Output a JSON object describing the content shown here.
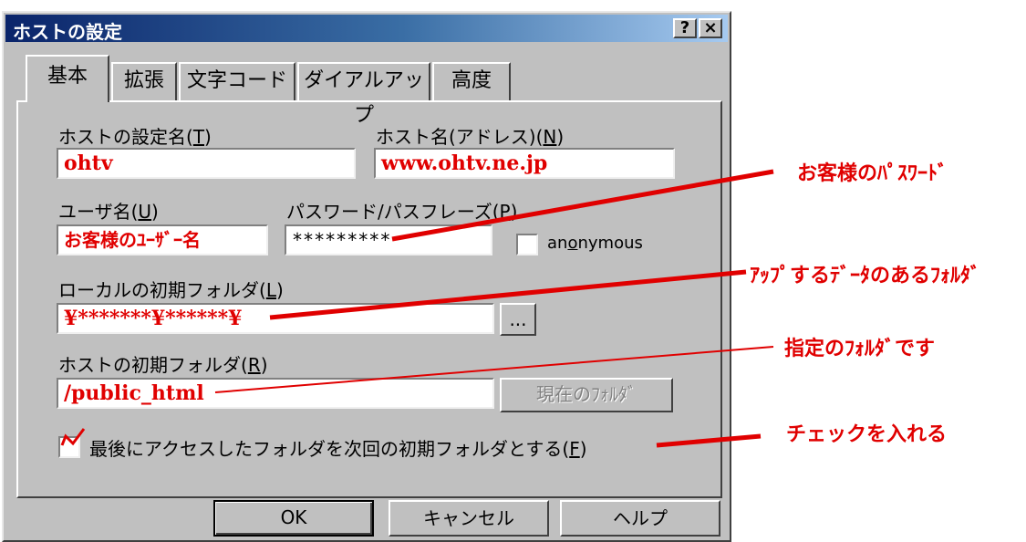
{
  "dialog": {
    "title": "ホストの設定",
    "help_button": "?",
    "close_button": "×"
  },
  "tabs": [
    "基本",
    "拡張",
    "文字コード",
    "ダイアルアップ",
    "高度"
  ],
  "fields": {
    "setting_name": {
      "label_pre": "ホストの設定名(",
      "label_key": "T",
      "label_post": ")",
      "value": "ohtv"
    },
    "host_name": {
      "label_pre": "ホスト名(アドレス)(",
      "label_key": "N",
      "label_post": ")",
      "value": "www.ohtv.ne.jp"
    },
    "username": {
      "label_pre": "ユーザ名(",
      "label_key": "U",
      "label_post": ")",
      "value": "お客様のﾕｰｻﾞｰ名"
    },
    "password": {
      "label_pre": "パスワード/パスフレーズ(",
      "label_key": "P",
      "label_post": ")",
      "value": "*********"
    },
    "anonymous": {
      "label_pre": "an",
      "label_key": "o",
      "label_post": "nymous",
      "checked": false
    },
    "local_folder": {
      "label_pre": "ローカルの初期フォルダ(",
      "label_key": "L",
      "label_post": ")",
      "value": "¥*******¥******¥",
      "browse": "..."
    },
    "host_folder": {
      "label_pre": "ホストの初期フォルダ(",
      "label_key": "R",
      "label_post": ")",
      "value": "/public_html",
      "current_button": "現在のﾌｫﾙﾀﾞ"
    },
    "last_folder": {
      "label_pre": "最後にアクセスしたフォルダを次回の初期フォルダとする(",
      "label_key": "F",
      "label_post": ")",
      "checked": true
    }
  },
  "buttons": {
    "ok": "OK",
    "cancel": "キャンセル",
    "help": "ヘルプ"
  },
  "annotations": {
    "password": "お客様のﾊﾟｽﾜｰﾄﾞ",
    "local_folder": "ｱｯﾌﾟするﾃﾞｰﾀのあるﾌｫﾙﾀﾞ",
    "host_folder": "指定のﾌｫﾙﾀﾞです",
    "checkbox": "チェックを入れる"
  },
  "colors": {
    "annotation": "#e00000",
    "dialog_bg": "#c0c0c0",
    "titlebar": "#0a246a"
  }
}
